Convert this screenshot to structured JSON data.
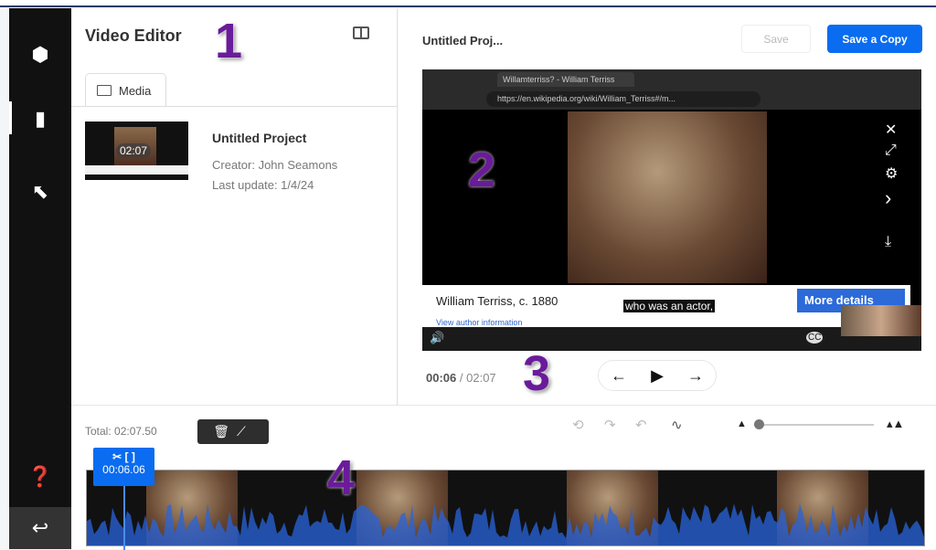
{
  "sidebar": {
    "items": [
      {
        "icon": "cube-icon"
      },
      {
        "icon": "film-icon",
        "active": true
      },
      {
        "icon": "cursor-select-icon"
      }
    ],
    "help_icon": "help-icon",
    "back_icon": "back-icon"
  },
  "left_panel": {
    "title": "Video Editor",
    "tab": "Media",
    "project": {
      "thumb_duration": "02:07",
      "name": "Untitled Project",
      "creator": "Creator: John Seamons",
      "updated": "Last update: 1/4/24"
    }
  },
  "header": {
    "project_title": "Untitled Proj...",
    "save_label": "Save",
    "save_copy_label": "Save a Copy",
    "accent": "#0a6cf0"
  },
  "video": {
    "browser_tab": "Willamterriss? - William Terriss",
    "url": "https://en.wikipedia.org/wiki/William_Terriss#/m...",
    "caption": "William Terriss, c. 1880",
    "subtitle": "who was an actor,",
    "more_details": "More details",
    "author_link": "View author information",
    "cc": "CC"
  },
  "playback": {
    "current": "00:06",
    "separator": "/",
    "duration": "02:07"
  },
  "timeline": {
    "total": "Total: 02:07.50",
    "playhead_time": "00:06.06"
  },
  "annotations": [
    "1",
    "2",
    "3",
    "4"
  ]
}
